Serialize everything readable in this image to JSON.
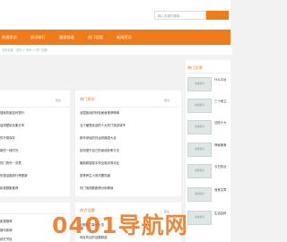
{
  "search": {
    "placeholder": "输入关键词搜索..."
  },
  "nav": [
    "热搜资讯",
    "热词排行",
    "搜索频道",
    "热门话题",
    "新闻资讯"
  ],
  "breadcrumb": "当前位置：首页 > 资讯 > 热门话题",
  "left_panel": {
    "more": "更多",
    "items": [
      "搜索热度如何提升",
      "高清壁纸合集分享",
      "的不易保存",
      "新的一段时光",
      "热门资讯一览表",
      "热搜话题排行榜更新",
      "影视剧集推荐"
    ]
  },
  "mid_panel": {
    "title": "热门资讯",
    "more": "更多",
    "items": [
      "全国各地的特色美食推荐榜单",
      "当下最受欢迎的十大热门旅游城市",
      "新年伊始的好运祝福语大全",
      "如何提升自己的阅读效率方法",
      "最新款智能手机全面评测对比",
      "夏季养生小常识要知道",
      "热门电视剧剧情分析解读"
    ]
  },
  "lower_left": {
    "items": [
      "影视推荐",
      "娱乐新闻",
      "综艺节目"
    ]
  },
  "lower_panel": {
    "title": "热点话题",
    "more": "更多",
    "items": [
      "近期热门事件一览",
      "网友热议的话题精选"
    ]
  },
  "sidebar": {
    "title": "热门文章",
    "thumb_label": "热搜资讯",
    "items": [
      "什么平台",
      "三十而立",
      "沈阳十大",
      "神秘美食",
      "今日热点",
      "深夜文章",
      "生活百科"
    ]
  },
  "watermark": "0401导航网"
}
